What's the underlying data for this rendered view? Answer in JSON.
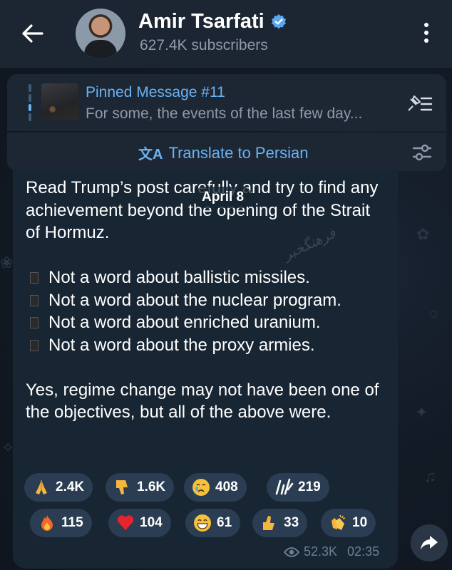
{
  "header": {
    "channel_name": "Amir Tsarfati",
    "subscribers": "627.4K subscribers"
  },
  "pinned": {
    "title": "Pinned Message #11",
    "preview": "For some, the events of the last few day..."
  },
  "translate": {
    "label": "Translate to Persian"
  },
  "message": {
    "date": "April 8",
    "paragraphs": [
      "Read Trump’s post carefully and try to find any achievement beyond the opening of the Strait of Hormuz.",
      "Not a word about ballistic missiles.",
      "Not a word about the nuclear program.",
      "Not a word about enriched uranium.",
      "Not a word about the proxy armies.",
      "Yes, regime change may not have been one of the objectives, but all of the above were."
    ],
    "views": "52.3K",
    "time": "02:35"
  },
  "reactions": [
    {
      "emoji": "praying-hands",
      "count": "2.4K"
    },
    {
      "emoji": "thumbs-down",
      "count": "1.6K"
    },
    {
      "emoji": "crying-face",
      "count": "408"
    },
    {
      "emoji": "custom-emoji",
      "count": "219"
    },
    {
      "emoji": "fire",
      "count": "115"
    },
    {
      "emoji": "red-heart",
      "count": "104"
    },
    {
      "emoji": "grinning-face",
      "count": "61"
    },
    {
      "emoji": "thumbs-up",
      "count": "33"
    },
    {
      "emoji": "clapping-hands",
      "count": "10"
    }
  ],
  "colors": {
    "accent": "#6ab2f2",
    "header_bg": "#1c2633",
    "bubble_bg": "#182533",
    "reaction_bg": "#2b3d52",
    "muted": "#8d9aa8"
  }
}
